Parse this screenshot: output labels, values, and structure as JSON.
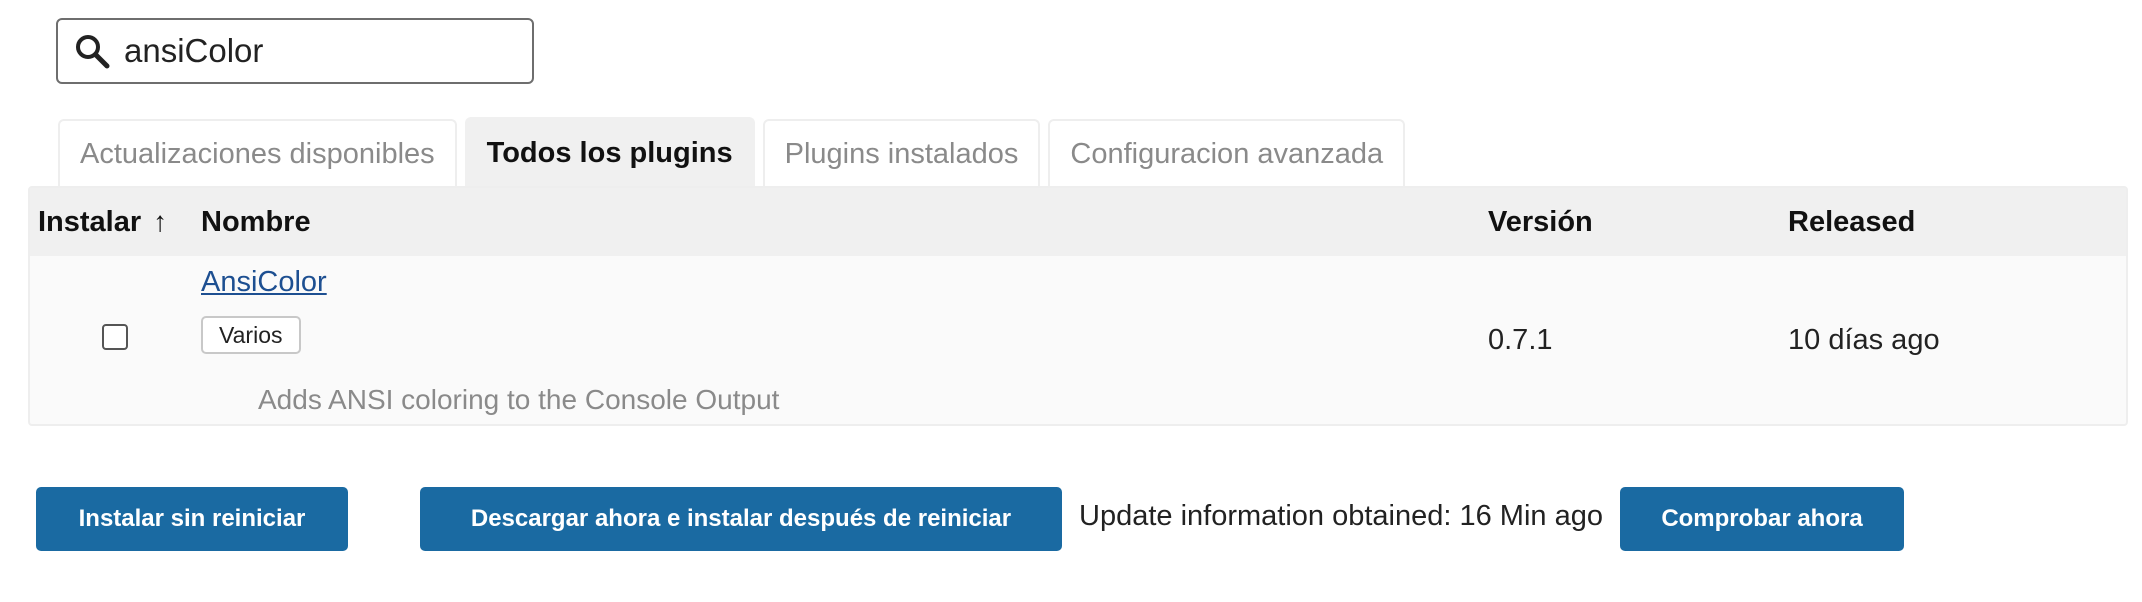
{
  "search": {
    "value": "ansiColor",
    "icon": "search-icon"
  },
  "tabs": [
    {
      "label": "Actualizaciones disponibles",
      "active": false
    },
    {
      "label": "Todos los plugins",
      "active": true
    },
    {
      "label": "Plugins instalados",
      "active": false
    },
    {
      "label": "Configuracion avanzada",
      "active": false
    }
  ],
  "table": {
    "headers": {
      "install": "Instalar",
      "sort_indicator": "↑",
      "name": "Nombre",
      "version": "Versión",
      "released": "Released"
    },
    "rows": [
      {
        "checked": false,
        "name": "AnsiColor",
        "tag": "Varios",
        "description": "Adds ANSI coloring to the Console Output",
        "version": "0.7.1",
        "released": "10 días ago"
      }
    ]
  },
  "footer": {
    "install_without_restart": "Instalar sin reiniciar",
    "download_install_after_restart": "Descargar ahora e instalar después de reiniciar",
    "update_info": "Update information obtained: 16 Min ago",
    "check_now": "Comprobar ahora"
  },
  "colors": {
    "primary_button": "#1a6aa2",
    "link": "#1d4f91",
    "header_bg": "#f0f0f0"
  }
}
